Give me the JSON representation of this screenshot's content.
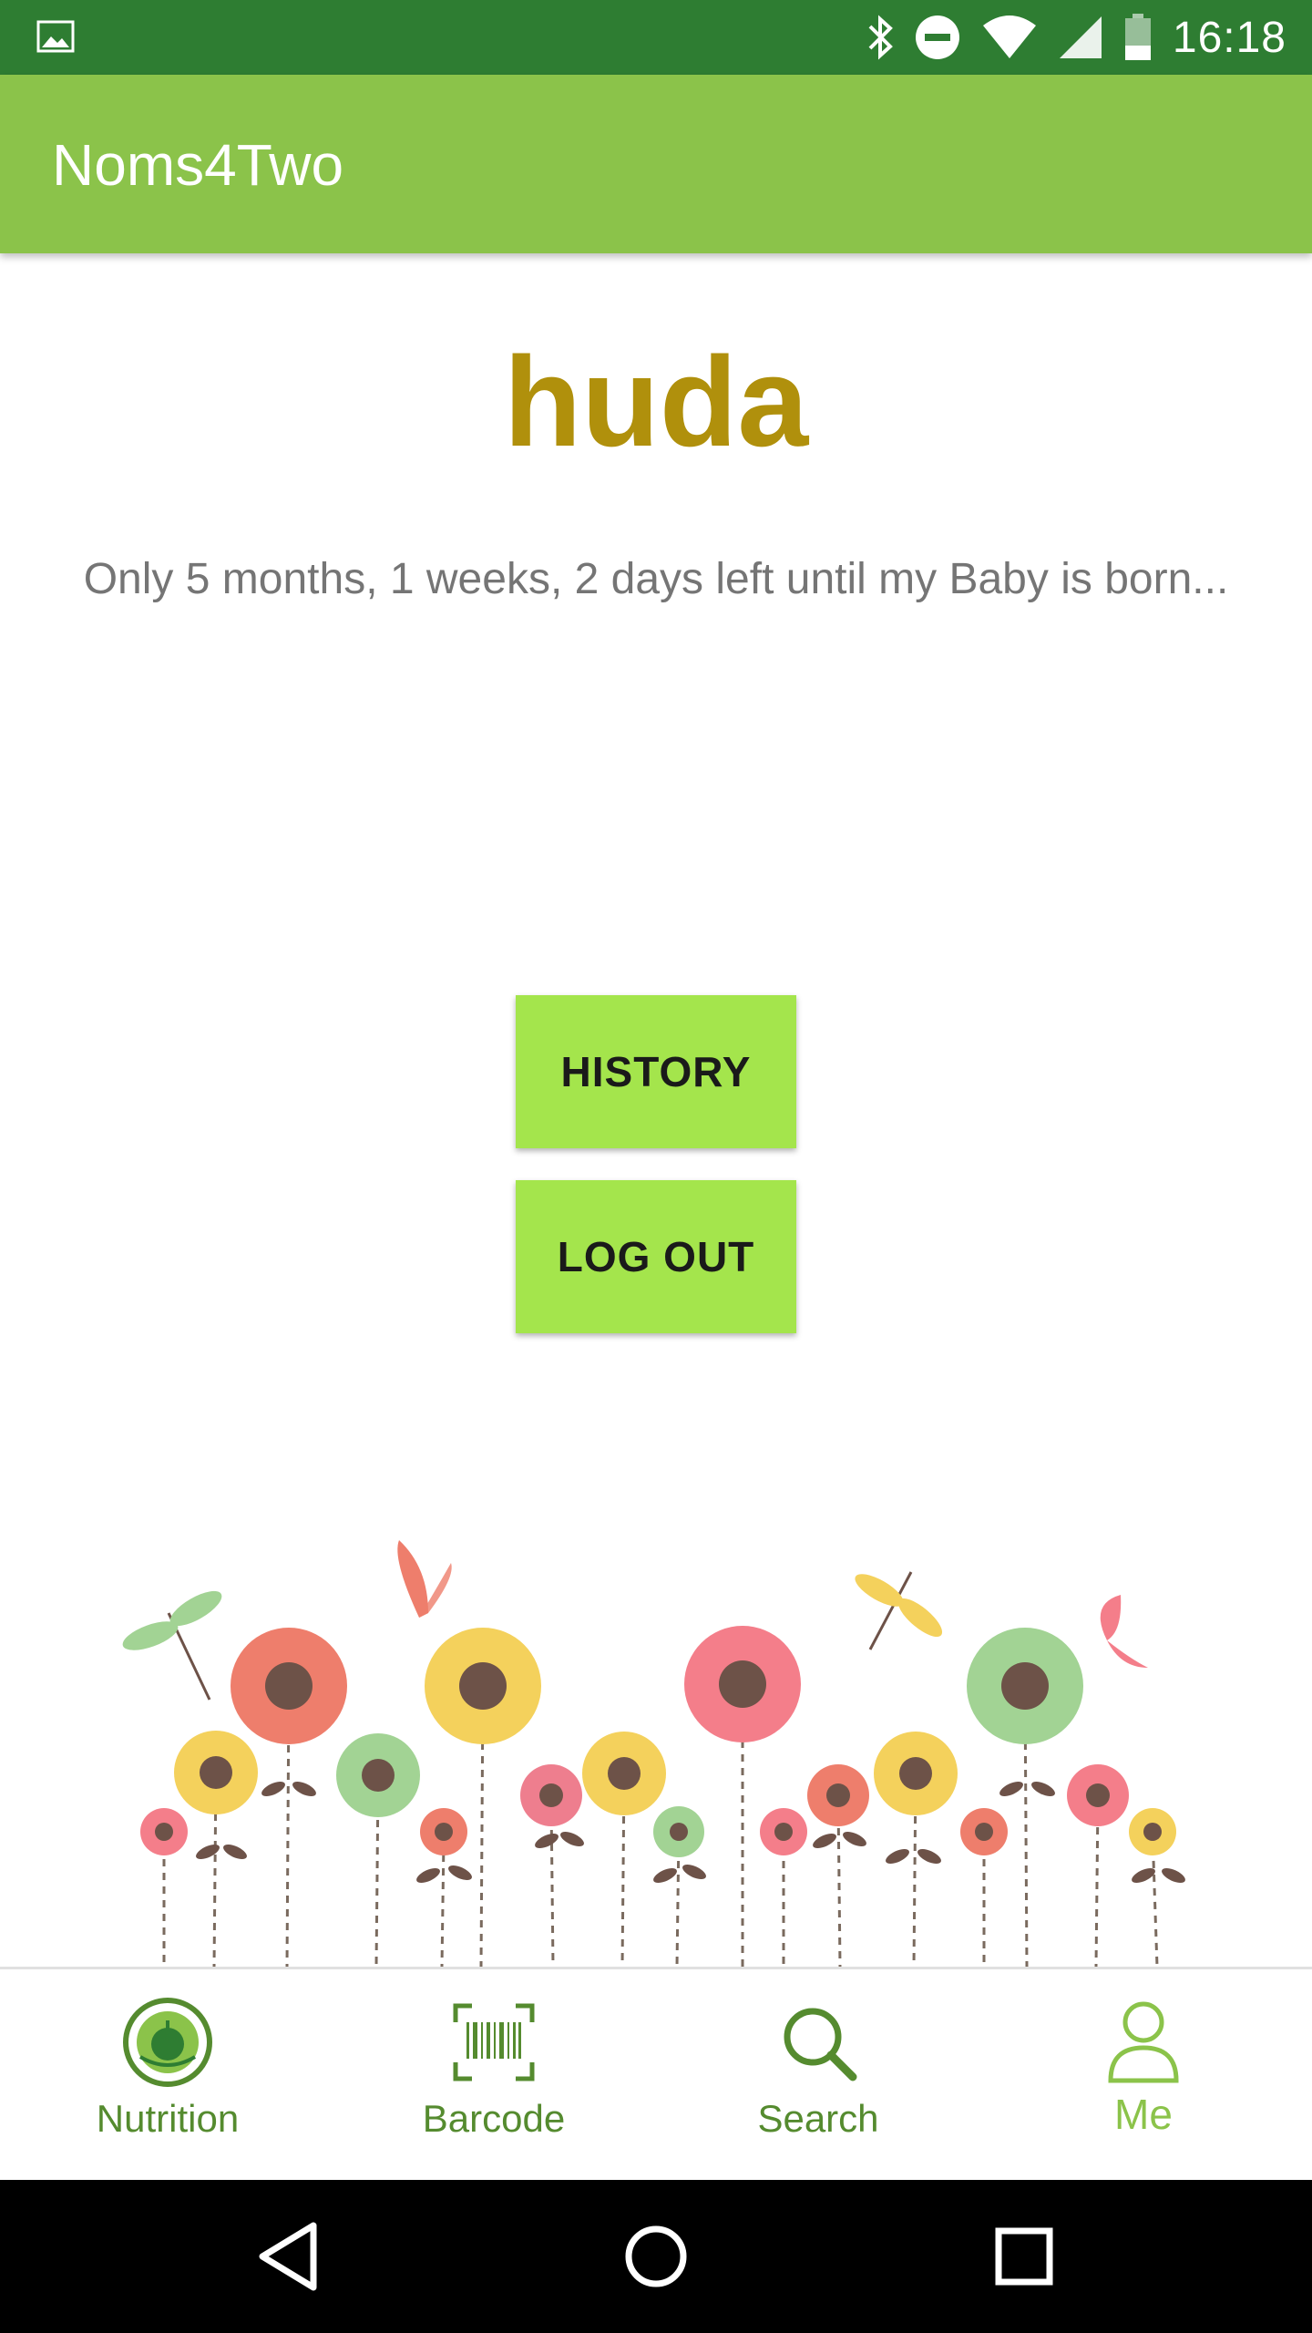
{
  "status_bar": {
    "time": "16:18",
    "icons": [
      "image-notification-icon",
      "bluetooth-icon",
      "do-not-disturb-icon",
      "wifi-icon",
      "cell-signal-icon",
      "battery-icon"
    ]
  },
  "app_bar": {
    "title": "Noms4Two"
  },
  "profile": {
    "username": "huda",
    "countdown": "Only 5 months, 1 weeks, 2 days left until my Baby is born..."
  },
  "buttons": {
    "history": "HISTORY",
    "logout": "LOG OUT"
  },
  "bottom_nav": {
    "items": [
      {
        "label": "Nutrition",
        "icon": "nutrition-icon"
      },
      {
        "label": "Barcode",
        "icon": "barcode-icon"
      },
      {
        "label": "Search",
        "icon": "search-icon"
      },
      {
        "label": "Me",
        "icon": "person-icon"
      }
    ],
    "selected": "Me"
  },
  "colors": {
    "status_bar": "#2e7d32",
    "app_bar": "#8bc34a",
    "username": "#b0900c",
    "button": "#a4e54c",
    "nav_label": "#558b2f",
    "nav_selected": "#8bc34a"
  }
}
